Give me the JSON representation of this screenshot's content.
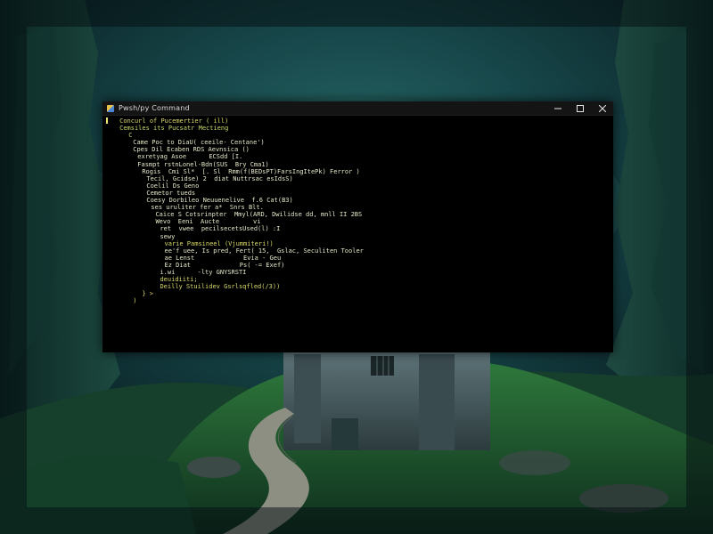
{
  "window": {
    "title": "Pwsh/py Command",
    "controls": {
      "minimize": "minimize",
      "maximize": "maximize",
      "close": "close"
    }
  },
  "console": {
    "lines": [
      {
        "indent": 3,
        "text": "Concurl of Pucemertier ( ill)",
        "color": "#d9d96a"
      },
      {
        "indent": 3,
        "text": "Cemsiles its Pucsatr Mectieng",
        "color": "#c9d66a"
      },
      {
        "indent": 5,
        "text": "C",
        "color": "#c9d66a"
      },
      {
        "indent": 6,
        "text": "Came Poc to DiaU( ceeile- Centane')",
        "color": "#e6e6c8"
      },
      {
        "indent": 6,
        "text": "Cpes Dil Ecaben RDS Aevnsica ()",
        "color": "#e6e6c8"
      },
      {
        "indent": 7,
        "text": "exretyag Asoe      ECSdd [I.",
        "color": "#e6e6c8"
      },
      {
        "indent": 7,
        "text": "Fasmpt rstnLonel-Bdn(SUS  Bry Cma1)",
        "color": "#e6e6c8"
      },
      {
        "indent": 8,
        "text": "Rogis  Cmi Sl*  [. Sl  Rmm(f(BEDsPT)FarsIngItePk) Ferror )",
        "color": "#e6e6c8"
      },
      {
        "indent": 9,
        "text": "Tecil, Gcidse) 2  diat Nuttrsac esIdsS)",
        "color": "#e6e6c8"
      },
      {
        "indent": 9,
        "text": "Coelil Ds Geno",
        "color": "#e6e6c8"
      },
      {
        "indent": 9,
        "text": "Cemetor tueds",
        "color": "#e6e6c8"
      },
      {
        "indent": 9,
        "text": "Coesy Dorbileo Neuuenelive  f.6 Cat(B3)",
        "color": "#e6e6c8"
      },
      {
        "indent": 10,
        "text": "ses uruliter fer a*  Snrs Blt.",
        "color": "#e6e6c8"
      },
      {
        "indent": 11,
        "text": "Caice S Cotsrinpter  Mmyl(ARD, Dwilidse dd, mnll II 2BS",
        "color": "#e6e6c8"
      },
      {
        "indent": 11,
        "text": "Wevo  Eeni  Aucte         vi",
        "color": "#e6e6c8"
      },
      {
        "indent": 12,
        "text": "ret  vwee  pecilsecetsUsed(l) :I",
        "color": "#e6e6c8"
      },
      {
        "indent": 12,
        "text": "sewy",
        "color": "#e6e6c8"
      },
      {
        "indent": 13,
        "text": "varie Pamsineel (Vjummiteri!)",
        "color": "#d9d96a"
      },
      {
        "indent": 13,
        "text": "ee'f uee, Is pred, Fert( 15,  Gslac, Seculiten Tooler",
        "color": "#e6e6c8"
      },
      {
        "indent": 13,
        "text": "ae Lenst             Evia - Geu",
        "color": "#e6e6c8"
      },
      {
        "indent": 13,
        "text": "Ez Diat             Ps( -= Exef)",
        "color": "#e6e6c8"
      },
      {
        "indent": 12,
        "text": "i.wi      -lty GNYSRSTI",
        "color": "#e6e6c8"
      },
      {
        "indent": 12,
        "text": "deuidiiti;",
        "color": "#d9d96a"
      },
      {
        "indent": 12,
        "text": "Deilly Stuilidev Gsrlsqfled(/3))",
        "color": "#d9d96a"
      },
      {
        "indent": 8,
        "text": "} >",
        "color": "#d9d96a"
      },
      {
        "indent": 6,
        "text": ")",
        "color": "#d9d96a"
      }
    ]
  },
  "colors": {
    "terminal_bg": "#000000",
    "titlebar_bg": "#141414",
    "text_yellow": "#d9d96a",
    "text_white": "#e6e6c8"
  },
  "desktop": {
    "wallpaper": "dark teal misty cliffs with stone tower and winding path"
  }
}
